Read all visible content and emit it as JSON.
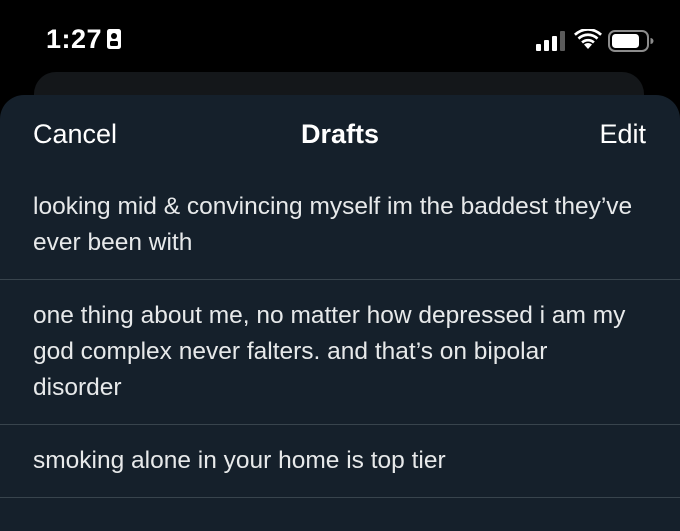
{
  "status_bar": {
    "time": "1:27",
    "icons": [
      "badge-icon",
      "cellular-signal-icon",
      "wifi-icon",
      "battery-icon"
    ]
  },
  "colors": {
    "background": "#000000",
    "sheet": "#15202b",
    "divider": "#38444d",
    "text": "#ffffff"
  },
  "nav": {
    "cancel_label": "Cancel",
    "title": "Drafts",
    "edit_label": "Edit"
  },
  "drafts": [
    {
      "text": "looking mid & convincing myself im the baddest they’ve ever been with"
    },
    {
      "text": "one thing about me, no matter how depressed i am my god complex never falters. and that’s on bipolar disorder"
    },
    {
      "text": "smoking alone in your home is top tier"
    }
  ]
}
